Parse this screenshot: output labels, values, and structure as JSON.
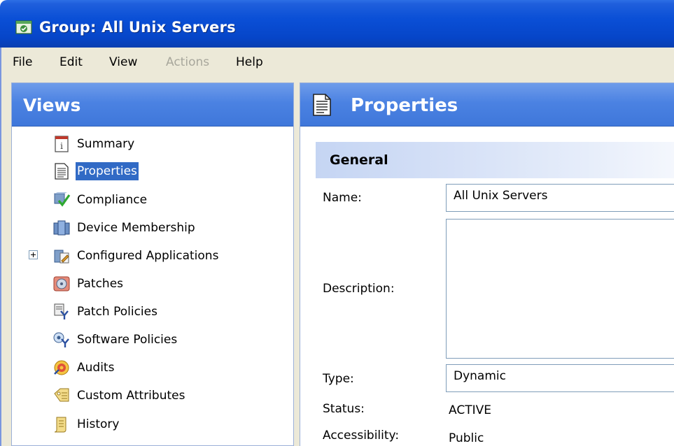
{
  "window": {
    "title": "Group: All Unix Servers",
    "icon": "group-window-icon"
  },
  "menu": [
    {
      "label": "File",
      "enabled": true
    },
    {
      "label": "Edit",
      "enabled": true
    },
    {
      "label": "View",
      "enabled": true
    },
    {
      "label": "Actions",
      "enabled": false
    },
    {
      "label": "Help",
      "enabled": true
    }
  ],
  "views": {
    "header": "Views",
    "items": [
      {
        "label": "Summary",
        "icon": "summary-icon",
        "selected": false
      },
      {
        "label": "Properties",
        "icon": "properties-icon",
        "selected": true
      },
      {
        "label": "Compliance",
        "icon": "compliance-icon",
        "selected": false
      },
      {
        "label": "Device Membership",
        "icon": "device-membership-icon",
        "selected": false
      },
      {
        "label": "Configured Applications",
        "icon": "configured-applications-icon",
        "selected": false,
        "expandable": true
      },
      {
        "label": "Patches",
        "icon": "patches-icon",
        "selected": false
      },
      {
        "label": "Patch Policies",
        "icon": "patch-policies-icon",
        "selected": false
      },
      {
        "label": "Software Policies",
        "icon": "software-policies-icon",
        "selected": false
      },
      {
        "label": "Audits",
        "icon": "audits-icon",
        "selected": false
      },
      {
        "label": "Custom Attributes",
        "icon": "custom-attributes-icon",
        "selected": false
      },
      {
        "label": "History",
        "icon": "history-icon",
        "selected": false
      }
    ]
  },
  "properties": {
    "header": "Properties",
    "section": "General",
    "name": {
      "label": "Name:",
      "value": "All Unix Servers"
    },
    "description": {
      "label": "Description:",
      "value": ""
    },
    "type": {
      "label": "Type:",
      "value": "Dynamic"
    },
    "status": {
      "label": "Status:",
      "value": "ACTIVE"
    },
    "accessibility": {
      "label": "Accessibility:",
      "value": "Public"
    }
  },
  "colors": {
    "titlebar": "#0a4fd6",
    "panel_header": "#4b82e2",
    "selection": "#316ac5",
    "menubar": "#ece9d8"
  }
}
